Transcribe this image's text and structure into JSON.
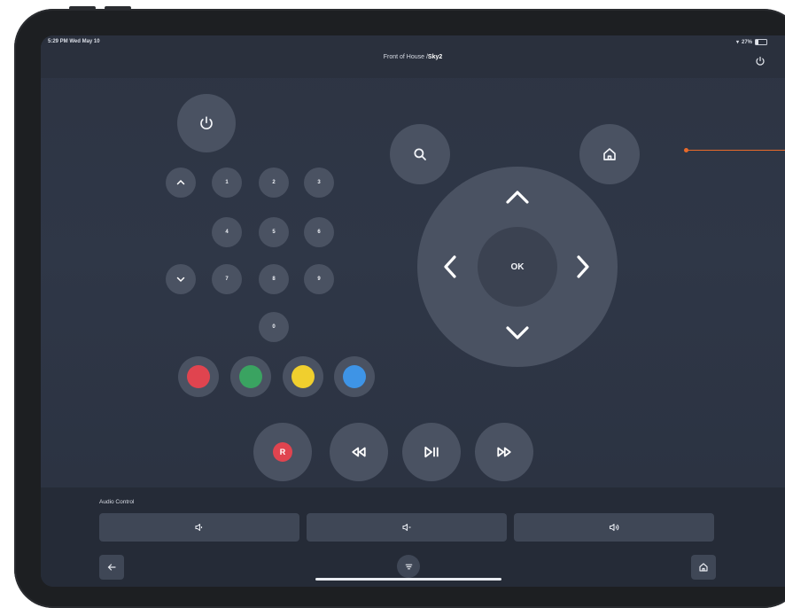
{
  "status": {
    "time_date": "5:29 PM  Wed May 10",
    "battery": "27%"
  },
  "header": {
    "location": "Front of House / ",
    "device": "Sky2"
  },
  "keypad": {
    "keys": [
      "1",
      "2",
      "3",
      "4",
      "5",
      "6",
      "7",
      "8",
      "9",
      "0"
    ]
  },
  "dpad": {
    "ok_label": "OK"
  },
  "transport": {
    "record_label": "R"
  },
  "colors": {
    "red": "#e0444f",
    "green": "#3aa361",
    "yellow": "#f0cf2e",
    "blue": "#3e94e6",
    "pointer": "#e86a2a"
  },
  "audio": {
    "label": "Audio Control"
  },
  "icons": {
    "power": "power-icon",
    "search": "search-icon",
    "home": "home-icon",
    "channel_up": "chevron-up-icon",
    "channel_down": "chevron-down-icon",
    "rewind": "rewind-icon",
    "play_pause": "play-pause-icon",
    "fast_forward": "fast-forward-icon",
    "vol_mute": "volume-mute-icon",
    "vol_down": "volume-down-icon",
    "vol_up": "volume-up-icon",
    "back": "back-arrow-icon",
    "menu": "menu-icon"
  }
}
